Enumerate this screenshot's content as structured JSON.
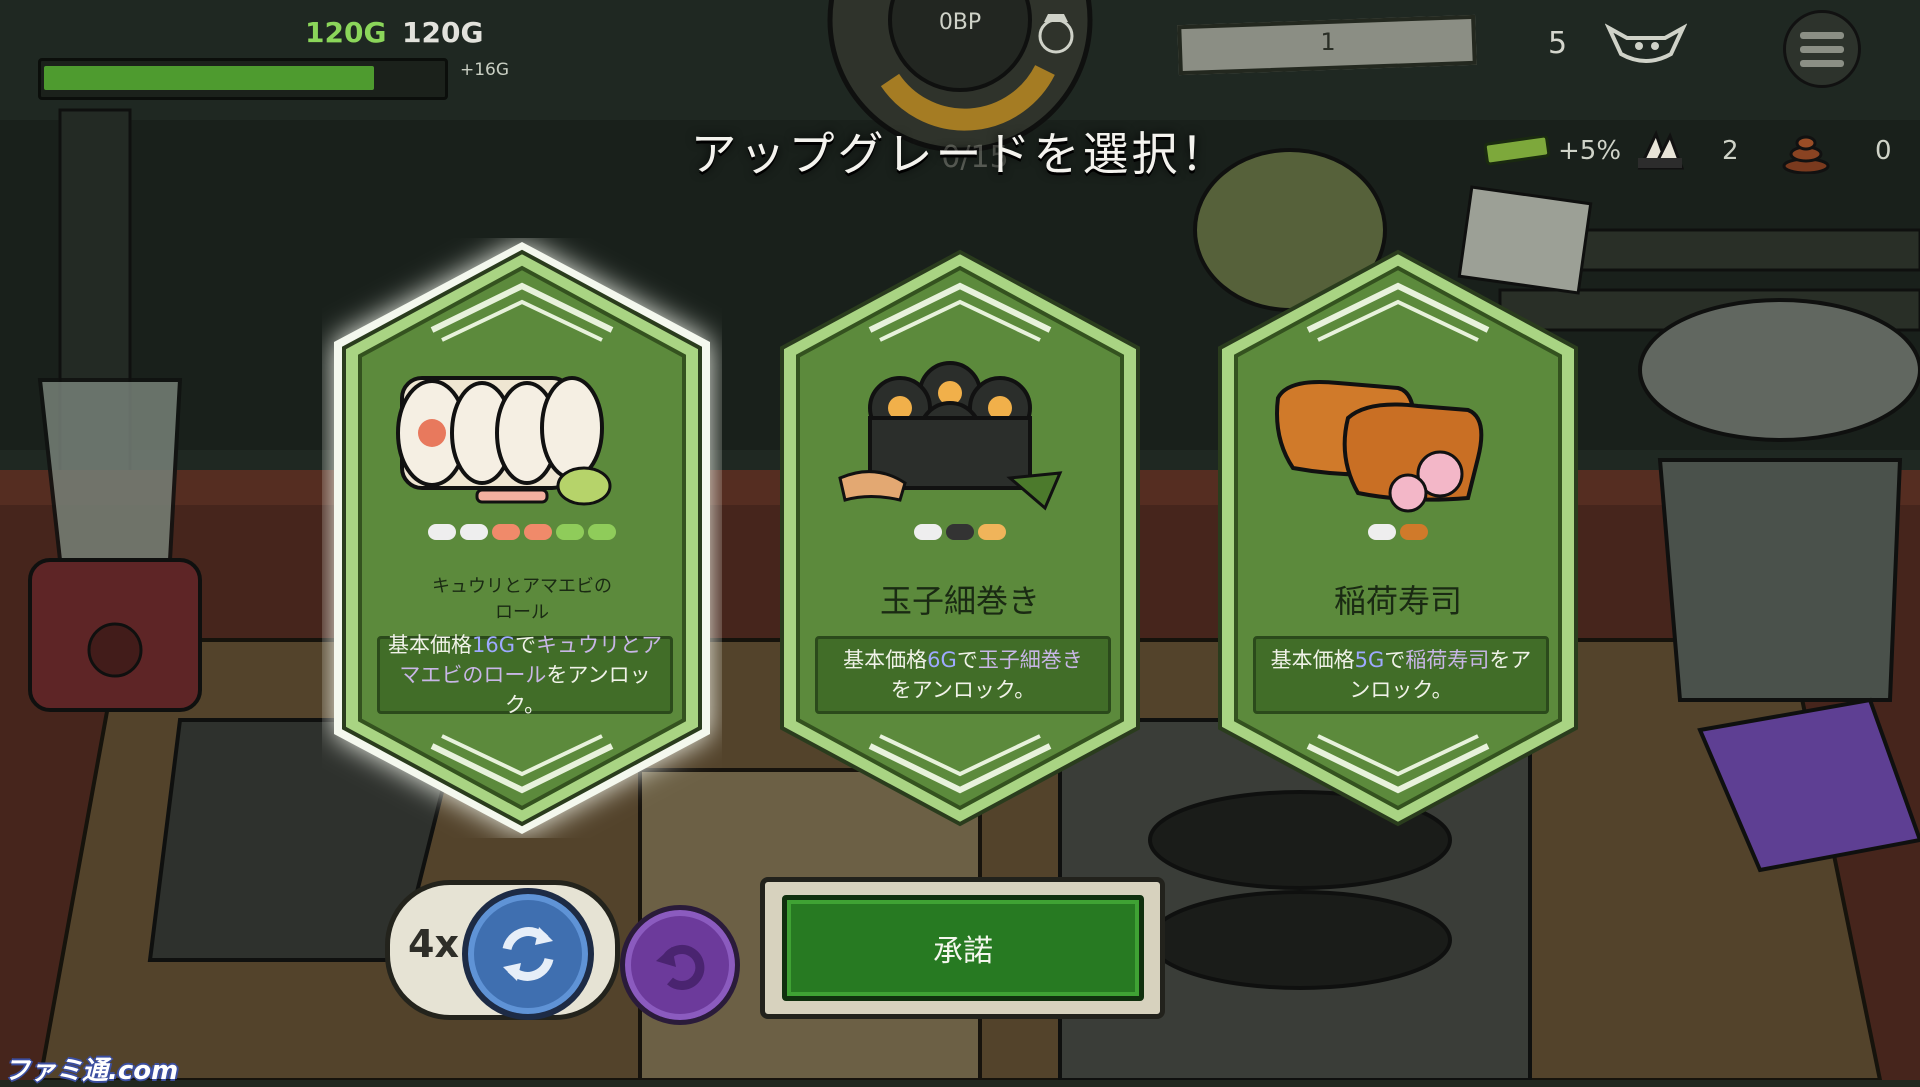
{
  "hud": {
    "gold_current": "120G",
    "gold_target": "120G",
    "gold_gain": "+16G",
    "progress_fraction": 0.83,
    "bp_label": "0BP",
    "wave_label": "1",
    "lives_count": "5",
    "bonus_pct": "+5%",
    "sushi_count": "2",
    "poop_count": "0",
    "order_counter": "0/15"
  },
  "title": "アップグレードを選択！",
  "cards": [
    {
      "name": "キュウリとアマエビの\nロール",
      "desc_prefix": "基本価格",
      "price": "16G",
      "desc_mid": "で",
      "item": "キュウリとアマエビのロール",
      "desc_suffix": "をアンロック。",
      "selected": true
    },
    {
      "name": "玉子細巻き",
      "desc_prefix": "基本価格",
      "price": "6G",
      "desc_mid": "で",
      "item": "玉子細巻き",
      "desc_suffix": "をアンロック。",
      "selected": false
    },
    {
      "name": "稲荷寿司",
      "desc_prefix": "基本価格",
      "price": "5G",
      "desc_mid": "で",
      "item": "稲荷寿司",
      "desc_suffix": "をアンロック。",
      "selected": false
    }
  ],
  "controls": {
    "reroll_count": "4x",
    "accept_label": "承諾"
  },
  "watermark": "ファミ通.com",
  "colors": {
    "card_green": "#5c8a3c",
    "card_border": "#b9e09a",
    "accept_green": "#277a22",
    "reroll_blue": "#3f6fb0",
    "undo_purple": "#6c3a9b"
  }
}
